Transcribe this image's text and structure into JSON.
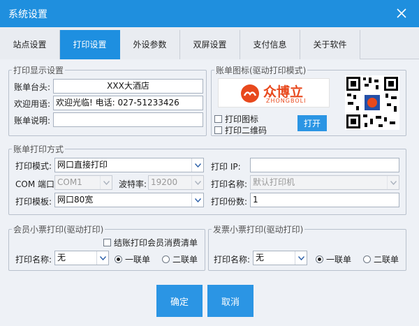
{
  "window": {
    "title": "系统设置"
  },
  "tabs": [
    {
      "label": "站点设置"
    },
    {
      "label": "打印设置"
    },
    {
      "label": "外设参数"
    },
    {
      "label": "双屏设置"
    },
    {
      "label": "支付信息"
    },
    {
      "label": "关于软件"
    }
  ],
  "active_tab": 1,
  "print_display": {
    "legend": "打印显示设置",
    "header_label": "账单台头:",
    "header_value": "XXX大酒店",
    "welcome_label": "欢迎用语:",
    "welcome_value": "欢迎光临! 电话: 027-51233426",
    "note_label": "账单说明:",
    "note_value": ""
  },
  "bill_icon": {
    "legend": "账单图标(驱动打印模式)",
    "logo_text": "众博立",
    "logo_sub": "ZHONGBOLI",
    "print_icon_label": "打印图标",
    "print_qr_label": "打印二维码",
    "open_button": "打开"
  },
  "print_method": {
    "legend": "账单打印方式",
    "mode_label": "打印模式:",
    "mode_value": "网口直接打印",
    "com_label": "COM 端口:",
    "com_value": "COM1",
    "baud_label": "波特率:",
    "baud_value": "19200",
    "template_label": "打印模板:",
    "template_value": "网口80宽",
    "ip_label": "打印 IP:",
    "ip_value": "",
    "printer_label": "打印名称:",
    "printer_value": "默认打印机",
    "copies_label": "打印份数:",
    "copies_value": "1"
  },
  "member_ticket": {
    "legend": "会员小票打印(驱动打印)",
    "checkout_label": "结账打印会员消费清单",
    "printer_label": "打印名称:",
    "printer_value": "无",
    "one_label": "一联单",
    "two_label": "二联单"
  },
  "invoice_ticket": {
    "legend": "发票小票打印(驱动打印)",
    "printer_label": "打印名称:",
    "printer_value": "无",
    "one_label": "一联单",
    "two_label": "二联单"
  },
  "footer": {
    "ok": "确定",
    "cancel": "取消"
  }
}
